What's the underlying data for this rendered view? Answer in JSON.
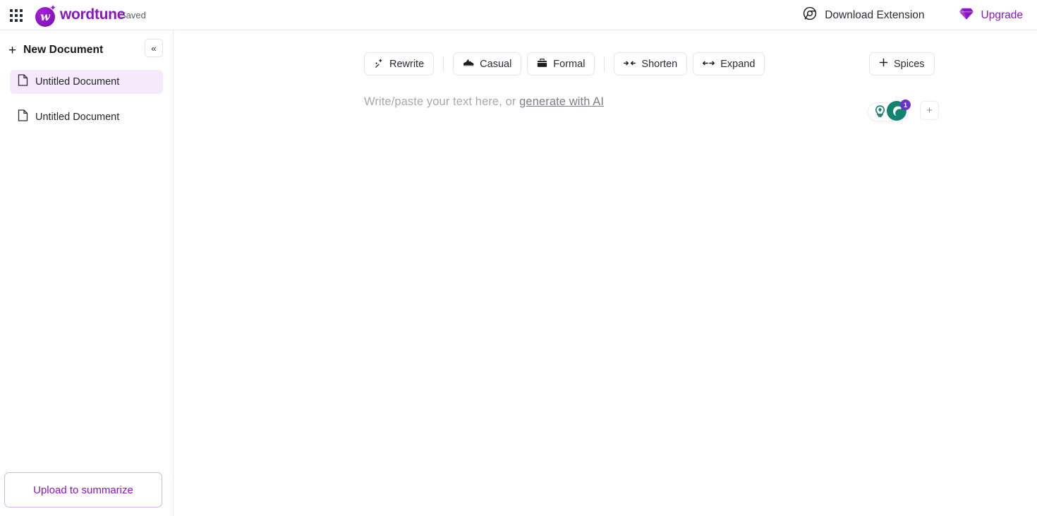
{
  "topbar": {
    "apps_icon": "apps-grid-icon",
    "brand": {
      "word": "wordtune",
      "mark_letter": "w",
      "sparkle": "✦"
    },
    "saved_status": "Saved",
    "download_extension": {
      "label": "Download Extension",
      "icon": "chrome-icon"
    },
    "upgrade": {
      "label": "Upgrade",
      "icon": "diamond-icon",
      "color": "#8a15c4"
    }
  },
  "sidebar": {
    "new_document": {
      "label": "New Document",
      "icon": "plus-icon"
    },
    "collapse": {
      "icon": "double-chevron-left-icon",
      "glyph": "«"
    },
    "documents": [
      {
        "label": "Untitled Document",
        "icon": "document-icon",
        "active": true
      },
      {
        "label": "Untitled Document",
        "icon": "document-icon",
        "active": false
      }
    ],
    "upload_button": {
      "label": "Upload to summarize"
    }
  },
  "toolbar": {
    "rewrite": {
      "label": "Rewrite",
      "icon": "sparkle-wand-icon"
    },
    "casual": {
      "label": "Casual",
      "icon": "sneaker-icon"
    },
    "formal": {
      "label": "Formal",
      "icon": "briefcase-icon"
    },
    "shorten": {
      "label": "Shorten",
      "icon": "arrows-inward-icon"
    },
    "expand": {
      "label": "Expand",
      "icon": "arrows-outward-icon"
    },
    "spices": {
      "label": "Spices",
      "icon": "plus-icon"
    }
  },
  "editor": {
    "placeholder_prefix": "Write/paste your text here, or ",
    "generate_link": "generate with AI",
    "assistant": {
      "bulb_icon": "lightbulb-gem-icon",
      "moon_icon": "crescent-icon",
      "badge_count": "1",
      "add_button_glyph": "+",
      "accent_teal": "#13826f",
      "badge_purple": "#6b33c9"
    }
  }
}
